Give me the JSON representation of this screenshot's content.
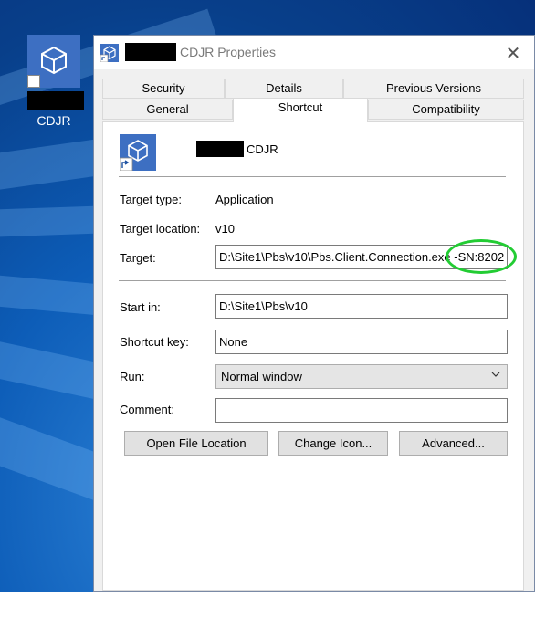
{
  "desktop": {
    "icon_name": "cube-icon",
    "shortcut_overlay": "shortcut-arrow-icon",
    "label": "CDJR"
  },
  "dialog": {
    "title": "CDJR Properties",
    "close_glyph": "✕",
    "tabs_top": [
      "Security",
      "Details",
      "Previous Versions"
    ],
    "tabs_bottom": [
      "General",
      "Shortcut",
      "Compatibility"
    ],
    "active_tab": "Shortcut",
    "shortcut": {
      "name": "CDJR",
      "target_type_label": "Target type:",
      "target_type_value": "Application",
      "target_location_label": "Target location:",
      "target_location_value": "v10",
      "target_label": "Target:",
      "target_value": "D:\\Site1\\Pbs\\v10\\Pbs.Client.Connection.exe -SN:8202",
      "start_in_label": "Start in:",
      "start_in_value": "D:\\Site1\\Pbs\\v10",
      "shortcut_key_label": "Shortcut key:",
      "shortcut_key_value": "None",
      "run_label": "Run:",
      "run_value": "Normal window",
      "comment_label": "Comment:",
      "comment_value": "",
      "buttons": {
        "open_file_location": "Open File Location",
        "change_icon": "Change Icon...",
        "advanced": "Advanced..."
      }
    }
  },
  "colors": {
    "highlight": "#22cc33",
    "desktop": "#0d5db8",
    "icon_bg": "#3d6fc2"
  }
}
